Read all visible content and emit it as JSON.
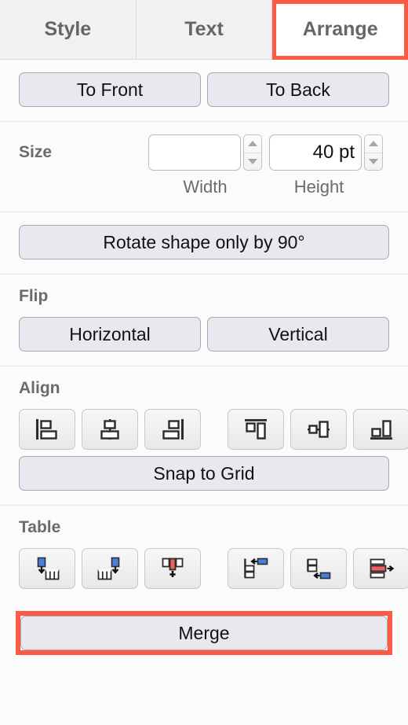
{
  "panel": {
    "tabs": [
      {
        "label": "Style",
        "active": false,
        "highlighted": false
      },
      {
        "label": "Text",
        "active": false,
        "highlighted": false
      },
      {
        "label": "Arrange",
        "active": true,
        "highlighted": true
      }
    ],
    "order": {
      "to_front_label": "To Front",
      "to_back_label": "To Back"
    },
    "size": {
      "title": "Size",
      "width_value": "",
      "width_placeholder": "",
      "width_sublabel": "Width",
      "height_value": "40 pt",
      "height_sublabel": "Height"
    },
    "rotate": {
      "label": "Rotate shape only by 90°"
    },
    "flip": {
      "title": "Flip",
      "horizontal_label": "Horizontal",
      "vertical_label": "Vertical"
    },
    "align": {
      "title": "Align",
      "buttons": [
        {
          "name": "align-left-icon"
        },
        {
          "name": "align-center-horizontal-icon"
        },
        {
          "name": "align-right-icon"
        },
        {
          "name": "align-top-icon"
        },
        {
          "name": "align-middle-vertical-icon"
        },
        {
          "name": "align-bottom-icon"
        }
      ],
      "snap_to_grid_label": "Snap to Grid"
    },
    "table": {
      "title": "Table",
      "buttons": [
        {
          "name": "insert-column-left-icon"
        },
        {
          "name": "insert-column-right-icon"
        },
        {
          "name": "delete-column-icon"
        },
        {
          "name": "insert-row-above-icon"
        },
        {
          "name": "insert-row-below-icon"
        },
        {
          "name": "delete-row-icon"
        }
      ],
      "merge_label": "Merge",
      "merge_highlighted": true
    },
    "colors": {
      "highlight": "#fb5a45",
      "button_face": "#e9e8ee",
      "button_border": "#a9a7b4",
      "tab_inactive_bg": "#f1f1f3",
      "tab_active_bg": "#ffffff",
      "label_gray": "#6b6b6b",
      "icon_blue": "#4a7fe0",
      "icon_red": "#f0605c",
      "panel_bg": "#fbfbfb"
    }
  }
}
